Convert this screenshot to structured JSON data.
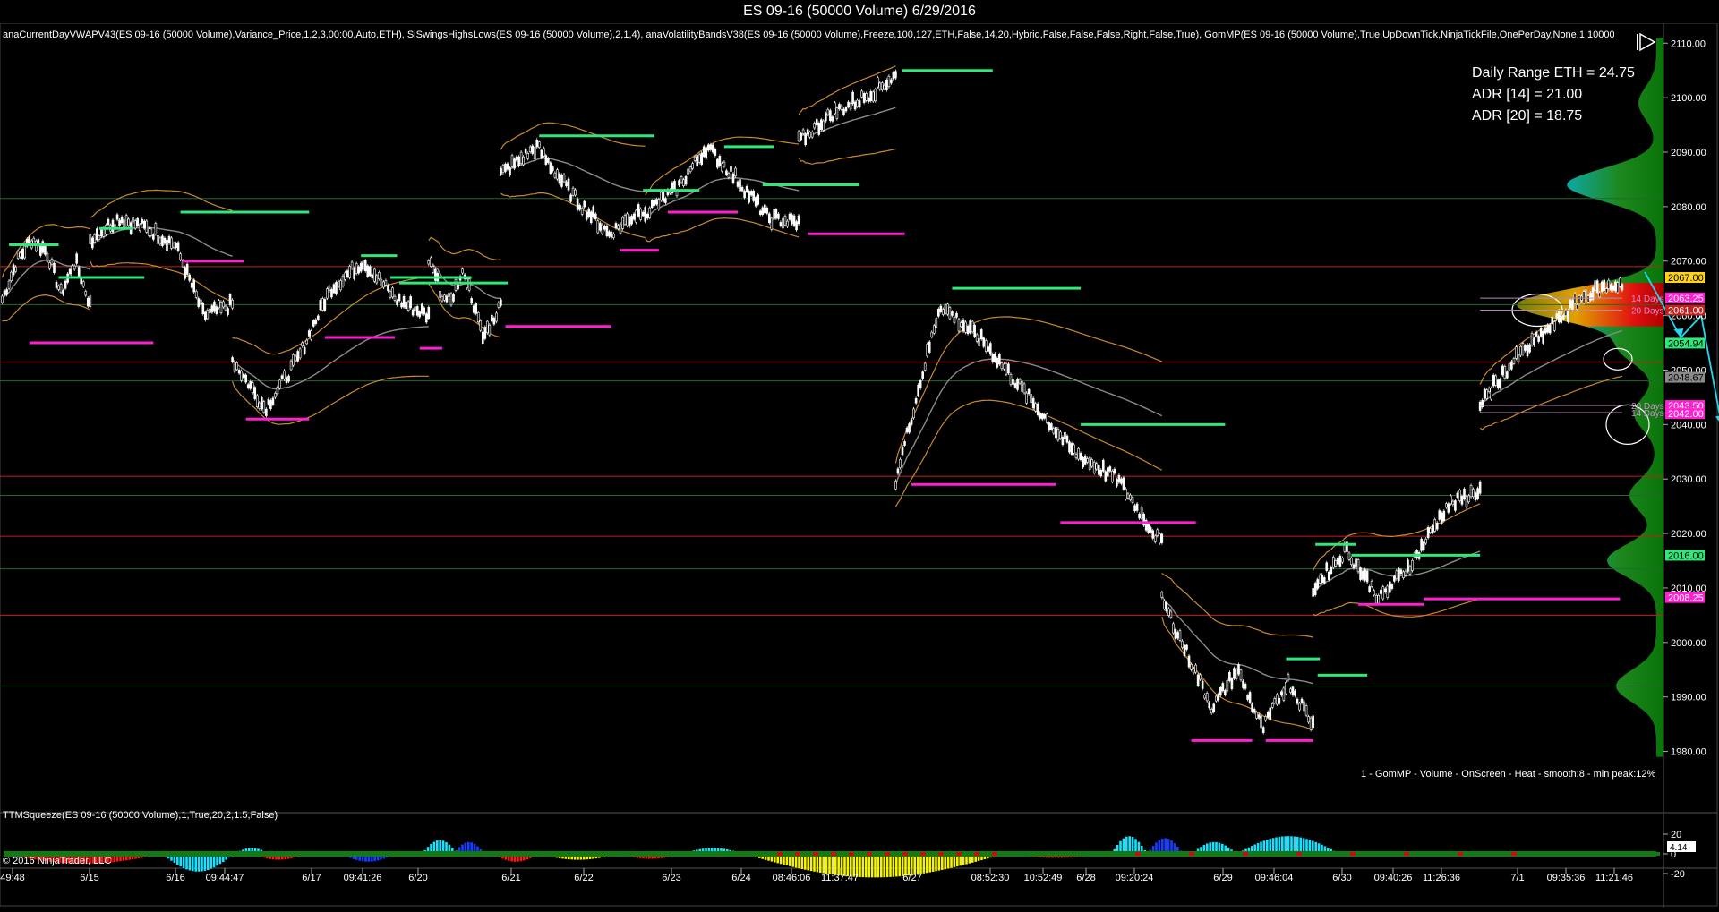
{
  "window": {
    "title": "ES 09-16 (50000 Volume)  6/29/2016",
    "indicators_text": "anaCurrentDayVWAPV43(ES 09-16 (50000 Volume),Variance_Price,1,2,3,00:00,Auto,ETH), SiSwingsHighsLows(ES 09-16 (50000 Volume),2,1,4), anaVolatilityBandsV38(ES 09-16 (50000 Volume),Freeze,100,127,ETH,False,14,20,Hybrid,False,False,False,Right,False,True), GomMP(ES 09-16 (50000 Volume),True,UpDownTick,NinjaTickFile,OnePerDay,None,1,1000000,1",
    "copyright": "© 2016 NinjaTrader, LLC",
    "pause_icon": "pause-play-icon"
  },
  "stats": {
    "daily_range": "Daily Range ETH = 24.75",
    "adr14": "ADR [14] = 21.00",
    "adr20": "ADR [20] = 18.75"
  },
  "gomp_label": "1 - GomMP - Volume - OnScreen - Heat - smooth:8 - min peak:12%",
  "squeeze": {
    "label": "TTMSqueeze(ES 09-16 (50000 Volume),1,True,20,2,1.5,False)",
    "axis_ticks": [
      "20",
      "0",
      "-20"
    ],
    "current_value": "4.14"
  },
  "colors": {
    "background": "#000000",
    "bar": "#ffffff",
    "swing_high": "#2ee87a",
    "swing_low": "#ff1fd0",
    "band": "#c9892c",
    "vwap": "#8a8a8a",
    "red_line": "#c0201e",
    "green_line": "#1f6b2a",
    "arrow": "#22d8f0",
    "histo_cyan": "#16e3ff",
    "histo_blue": "#1a3cff",
    "histo_red": "#ff1a1a",
    "histo_yellow": "#f5f500",
    "squeeze_green": "#127a12"
  },
  "chart_data": {
    "type": "candlestick",
    "ylim": [
      1975,
      2113
    ],
    "y_ticks": [
      1980,
      1990,
      2000,
      2010,
      2020,
      2030,
      2040,
      2050,
      2060,
      2070,
      2080,
      2090,
      2100,
      2110
    ],
    "y_tick_labels": [
      "1980.00",
      "1990.00",
      "2000.00",
      "2010.00",
      "2020.00",
      "2030.00",
      "2040.00",
      "2050.00",
      "2060.00",
      "2070.00",
      "2080.00",
      "2090.00",
      "2100.00",
      "2110.00"
    ],
    "x_tick_labels": [
      "49:48",
      "6/15",
      "6/16",
      "09:44:47",
      "6/17",
      "09:41:26",
      "6/20",
      "6/21",
      "6/22",
      "6/23",
      "6/24",
      "08:46:06",
      "11:37:47",
      "6/27",
      "08:52:30",
      "10:52:49",
      "6/28",
      "09:20:24",
      "6/29",
      "09:46:04",
      "6/30",
      "09:40:26",
      "11:26:36",
      "7/1",
      "09:35:36",
      "11:21:46"
    ],
    "price_markers": [
      {
        "value": "2067.00",
        "color": "#ffd21a",
        "text_color": "#000000"
      },
      {
        "value": "2063.25",
        "color": "#ff1fd0",
        "text_color": "#ffffff"
      },
      {
        "value": "2061.00",
        "color": "#c0201e",
        "text_color": "#ffffff"
      },
      {
        "value": "2054.94",
        "color": "#2ee87a",
        "text_color": "#000000"
      },
      {
        "value": "2048.67",
        "color": "#8a8a8a",
        "text_color": "#000000"
      },
      {
        "value": "2043.50",
        "color": "#ff1fd0",
        "text_color": "#ffffff"
      },
      {
        "value": "2042.00",
        "color": "#ff1fd0",
        "text_color": "#ffffff"
      },
      {
        "value": "2016.00",
        "color": "#2ee87a",
        "text_color": "#000000"
      },
      {
        "value": "2008.25",
        "color": "#ff1fd0",
        "text_color": "#ffffff"
      }
    ],
    "red_levels": [
      2069,
      2051.5,
      2030.5,
      2019.5,
      2005
    ],
    "green_levels": [
      2081.5,
      2062,
      2048,
      2027,
      2013.5,
      1992
    ],
    "band_labels": [
      {
        "text": "14 Days",
        "value": 2063.2
      },
      {
        "text": "20 Days",
        "value": 2061.0
      },
      {
        "text": "20 Days",
        "value": 2043.5
      },
      {
        "text": "14 Days",
        "value": 2042.2
      }
    ],
    "sessions": [
      {
        "start": 1,
        "end": 40,
        "open": 2065,
        "close": 2062,
        "high": 2072,
        "low": 2058,
        "path": [
          2063,
          2070,
          2074,
          2072,
          2064,
          2070,
          2062
        ]
      },
      {
        "start": 40,
        "end": 103,
        "open": 2076,
        "close": 2072,
        "high": 2079,
        "low": 2068,
        "path": [
          2074,
          2078,
          2076,
          2073,
          2060,
          2062
        ]
      },
      {
        "start": 103,
        "end": 190,
        "open": 2053,
        "close": 2063,
        "high": 2071,
        "low": 2041,
        "path": [
          2052,
          2043,
          2052,
          2065,
          2070,
          2063,
          2060
        ]
      },
      {
        "start": 190,
        "end": 222,
        "open": 2072,
        "close": 2065,
        "high": 2074,
        "low": 2058,
        "path": [
          2070,
          2062,
          2068,
          2056,
          2062
        ]
      },
      {
        "start": 222,
        "end": 286,
        "open": 2087,
        "close": 2080,
        "high": 2092,
        "low": 2073,
        "path": [
          2086,
          2091,
          2082,
          2075,
          2080
        ]
      },
      {
        "start": 286,
        "end": 354,
        "open": 2078,
        "close": 2086,
        "high": 2092,
        "low": 2076,
        "path": [
          2079,
          2083,
          2091,
          2085,
          2078,
          2077
        ]
      },
      {
        "start": 354,
        "end": 397,
        "open": 2091,
        "close": 2105,
        "high": 2106,
        "low": 2089,
        "path": [
          2092,
          2097,
          2100,
          2104
        ]
      },
      {
        "start": 397,
        "end": 515,
        "open": 2030,
        "close": 2018,
        "high": 2066,
        "low": 2017,
        "path": [
          2030,
          2062,
          2055,
          2045,
          2035,
          2030,
          2018
        ]
      },
      {
        "start": 515,
        "end": 582,
        "open": 2008,
        "close": 1985,
        "high": 2010,
        "low": 1982,
        "path": [
          2008,
          1998,
          1988,
          1995,
          1984,
          1993,
          1985
        ]
      },
      {
        "start": 582,
        "end": 656,
        "open": 2010,
        "close": 2028,
        "high": 2029,
        "low": 2006,
        "path": [
          2010,
          2017,
          2008,
          2015,
          2025,
          2028
        ]
      },
      {
        "start": 656,
        "end": 719,
        "open": 2045,
        "close": 2066,
        "high": 2067,
        "low": 2043,
        "path": [
          2044,
          2052,
          2058,
          2064,
          2066
        ]
      }
    ],
    "projection_path": [
      [
        729,
        2068
      ],
      [
        745,
        2056
      ],
      [
        754,
        2060
      ],
      [
        763,
        2040
      ]
    ],
    "swing_high_lines": [
      [
        4,
        26,
        2073
      ],
      [
        26,
        64,
        2067
      ],
      [
        44,
        59,
        2076
      ],
      [
        80,
        137,
        2079
      ],
      [
        160,
        176,
        2071
      ],
      [
        173,
        209,
        2067
      ],
      [
        177,
        225,
        2066
      ],
      [
        239,
        290,
        2093
      ],
      [
        285,
        310,
        2083
      ],
      [
        321,
        343,
        2091
      ],
      [
        338,
        381,
        2084
      ],
      [
        400,
        440,
        2105
      ],
      [
        422,
        479,
        2065
      ],
      [
        479,
        543,
        2040
      ],
      [
        583,
        601,
        2018
      ],
      [
        599,
        656,
        2016
      ],
      [
        570,
        585,
        1997
      ],
      [
        584,
        606,
        1994
      ]
    ],
    "swing_low_lines": [
      [
        13,
        68,
        2055
      ],
      [
        81,
        108,
        2070
      ],
      [
        109,
        137,
        2041
      ],
      [
        144,
        175,
        2056
      ],
      [
        186,
        196,
        2054
      ],
      [
        224,
        271,
        2058
      ],
      [
        275,
        292,
        2072
      ],
      [
        296,
        327,
        2079
      ],
      [
        358,
        401,
        2075
      ],
      [
        404,
        468,
        2029
      ],
      [
        470,
        530,
        2022
      ],
      [
        602,
        631,
        2007
      ],
      [
        631,
        718,
        2008
      ],
      [
        528,
        555,
        1982
      ],
      [
        561,
        582,
        1982
      ]
    ]
  },
  "volume_profile": {
    "description_free": "",
    "peaks": [
      {
        "price": 2062,
        "width": 155
      },
      {
        "price": 2084,
        "width": 100
      },
      {
        "price": 2054,
        "width": 40
      },
      {
        "price": 2042,
        "width": 25
      },
      {
        "price": 2015,
        "width": 55
      },
      {
        "price": 2027,
        "width": 30
      },
      {
        "price": 1992,
        "width": 45
      },
      {
        "price": 2099,
        "width": 20
      }
    ],
    "circles": [
      {
        "price": 2061,
        "rx": 28,
        "ry": 18,
        "x_offset": 1717
      },
      {
        "price": 2052,
        "rx": 16,
        "ry": 12,
        "x_offset": 1807
      },
      {
        "price": 2040,
        "rx": 24,
        "ry": 22,
        "x_offset": 1818
      }
    ]
  },
  "squeeze_histogram": [
    {
      "x0": 4,
      "x1": 180,
      "peak": -10,
      "color_pos": "#16e3ff",
      "color_neg": "#ff1a1a"
    },
    {
      "x0": 180,
      "x1": 260,
      "peak": -18,
      "color_neg": "#16e3ff"
    },
    {
      "x0": 260,
      "x1": 300,
      "peak": 6,
      "color_pos": "#16e3ff"
    },
    {
      "x0": 280,
      "x1": 340,
      "peak": -6,
      "color_neg": "#ff1a1a"
    },
    {
      "x0": 380,
      "x1": 440,
      "peak": -8,
      "color_neg": "#1a3cff"
    },
    {
      "x0": 470,
      "x1": 510,
      "peak": 14,
      "color_pos": "#16e3ff"
    },
    {
      "x0": 505,
      "x1": 540,
      "peak": 12,
      "color_pos": "#1a3cff"
    },
    {
      "x0": 550,
      "x1": 600,
      "peak": -8,
      "color_neg": "#ff1a1a"
    },
    {
      "x0": 600,
      "x1": 690,
      "peak": -6,
      "color_neg": "#f5f500"
    },
    {
      "x0": 690,
      "x1": 760,
      "peak": -5,
      "color_neg": "#ff1a1a"
    },
    {
      "x0": 760,
      "x1": 830,
      "peak": 6,
      "color_pos": "#16e3ff"
    },
    {
      "x0": 830,
      "x1": 1120,
      "peak": -24,
      "color_neg": "#f5f500"
    },
    {
      "x0": 1120,
      "x1": 1240,
      "peak": -4,
      "color_neg": "#ff1a1a"
    },
    {
      "x0": 1240,
      "x1": 1280,
      "peak": 18,
      "color_pos": "#16e3ff"
    },
    {
      "x0": 1280,
      "x1": 1320,
      "peak": 16,
      "color_pos": "#1a3cff"
    },
    {
      "x0": 1330,
      "x1": 1380,
      "peak": 12,
      "color_pos": "#16e3ff"
    },
    {
      "x0": 1380,
      "x1": 1495,
      "peak": 18,
      "color_pos": "#16e3ff"
    }
  ]
}
